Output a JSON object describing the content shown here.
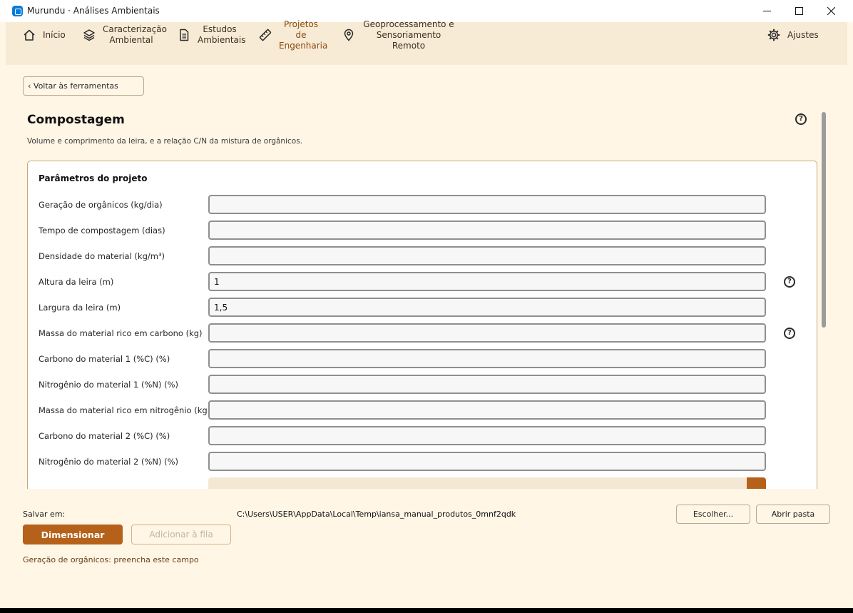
{
  "window": {
    "title": "Murundu · Análises Ambientais"
  },
  "nav": {
    "items": [
      {
        "label": "Início",
        "icon": "home-icon"
      },
      {
        "label": "Caracterização Ambiental",
        "icon": "layers-icon"
      },
      {
        "label": "Estudos Ambientais",
        "icon": "document-icon"
      },
      {
        "label": "Projetos de Engenharia",
        "icon": "ruler-icon",
        "active": true
      },
      {
        "label": "Geoprocessamento e Sensoriamento Remoto",
        "icon": "map-pin-icon"
      }
    ],
    "settings": {
      "label": "Ajustes",
      "icon": "gear-icon"
    }
  },
  "back_button": "‹ Voltar às ferramentas",
  "page": {
    "title": "Compostagem",
    "subtitle": "Volume e comprimento da leira, e a relação C/N da mistura de orgânicos."
  },
  "panel": {
    "title": "Parâmetros do projeto",
    "fields": [
      {
        "label": "Geração de orgânicos (kg/dia)",
        "value": ""
      },
      {
        "label": "Tempo de compostagem (dias)",
        "value": ""
      },
      {
        "label": "Densidade do material (kg/m³)",
        "value": ""
      },
      {
        "label": "Altura da leira (m)",
        "value": "1",
        "help": true
      },
      {
        "label": "Largura da leira (m)",
        "value": "1,5"
      },
      {
        "label": "Massa do material rico em carbono (kg)",
        "value": "",
        "help": true
      },
      {
        "label": "Carbono do material 1 (%C) (%)",
        "value": ""
      },
      {
        "label": "Nitrogênio do material 1 (%N) (%)",
        "value": ""
      },
      {
        "label": "Massa do material rico em nitrogênio (kg)",
        "value": ""
      },
      {
        "label": "Carbono do material 2 (%C) (%)",
        "value": ""
      },
      {
        "label": "Nitrogênio do material 2 (%N) (%)",
        "value": ""
      }
    ]
  },
  "footer": {
    "save_label": "Salvar em:",
    "save_path": "C:\\Users\\USER\\AppData\\Local\\Temp\\iansa_manual_produtos_0mnf2qdk",
    "choose_button": "Escolher...",
    "open_folder_button": "Abrir pasta",
    "primary_button": "Dimensionar",
    "queue_button": "Adicionar à fila",
    "status": "Geração de orgânicos: preencha este campo"
  },
  "colors": {
    "accent": "#b5611a",
    "background": "#fff6e6",
    "nav_background": "#f7ebd5"
  }
}
